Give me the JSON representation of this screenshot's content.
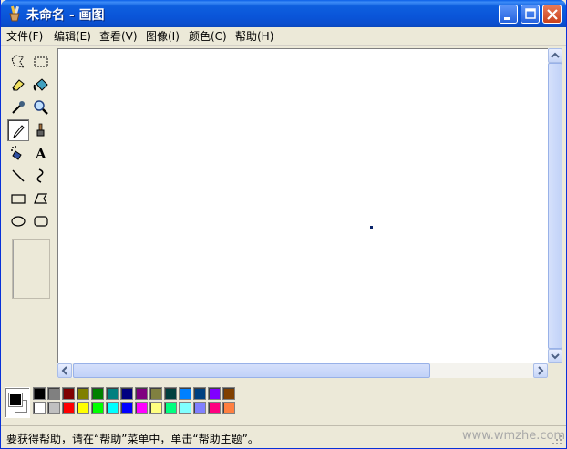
{
  "window": {
    "title": "未命名 - 画图"
  },
  "menu": [
    {
      "label": "文件(F)"
    },
    {
      "label": "编辑(E)"
    },
    {
      "label": "查看(V)"
    },
    {
      "label": "图像(I)"
    },
    {
      "label": "颜色(C)"
    },
    {
      "label": "帮助(H)"
    }
  ],
  "tools": [
    {
      "icon": "free-form-select-icon"
    },
    {
      "icon": "rect-select-icon"
    },
    {
      "icon": "eraser-icon"
    },
    {
      "icon": "fill-icon"
    },
    {
      "icon": "pick-color-icon"
    },
    {
      "icon": "magnifier-icon"
    },
    {
      "icon": "pencil-icon",
      "active": true
    },
    {
      "icon": "brush-icon"
    },
    {
      "icon": "airbrush-icon"
    },
    {
      "icon": "text-icon"
    },
    {
      "icon": "line-icon"
    },
    {
      "icon": "curve-icon"
    },
    {
      "icon": "rectangle-icon"
    },
    {
      "icon": "polygon-icon"
    },
    {
      "icon": "ellipse-icon"
    },
    {
      "icon": "rounded-rect-icon"
    }
  ],
  "palette": {
    "foreground": "#000000",
    "background": "#ffffff",
    "row1": [
      "#000000",
      "#808080",
      "#800000",
      "#808000",
      "#008000",
      "#008080",
      "#000080",
      "#800080",
      "#808040",
      "#004040",
      "#0080ff",
      "#004080",
      "#8000ff",
      "#804000"
    ],
    "row2": [
      "#ffffff",
      "#c0c0c0",
      "#ff0000",
      "#ffff00",
      "#00ff00",
      "#00ffff",
      "#0000ff",
      "#ff00ff",
      "#ffff80",
      "#00ff80",
      "#80ffff",
      "#8080ff",
      "#ff0080",
      "#ff8040"
    ]
  },
  "status": {
    "text": "要获得帮助，请在“帮助”菜单中，单击“帮助主题”。",
    "watermark": "www.wmzhe.com"
  }
}
